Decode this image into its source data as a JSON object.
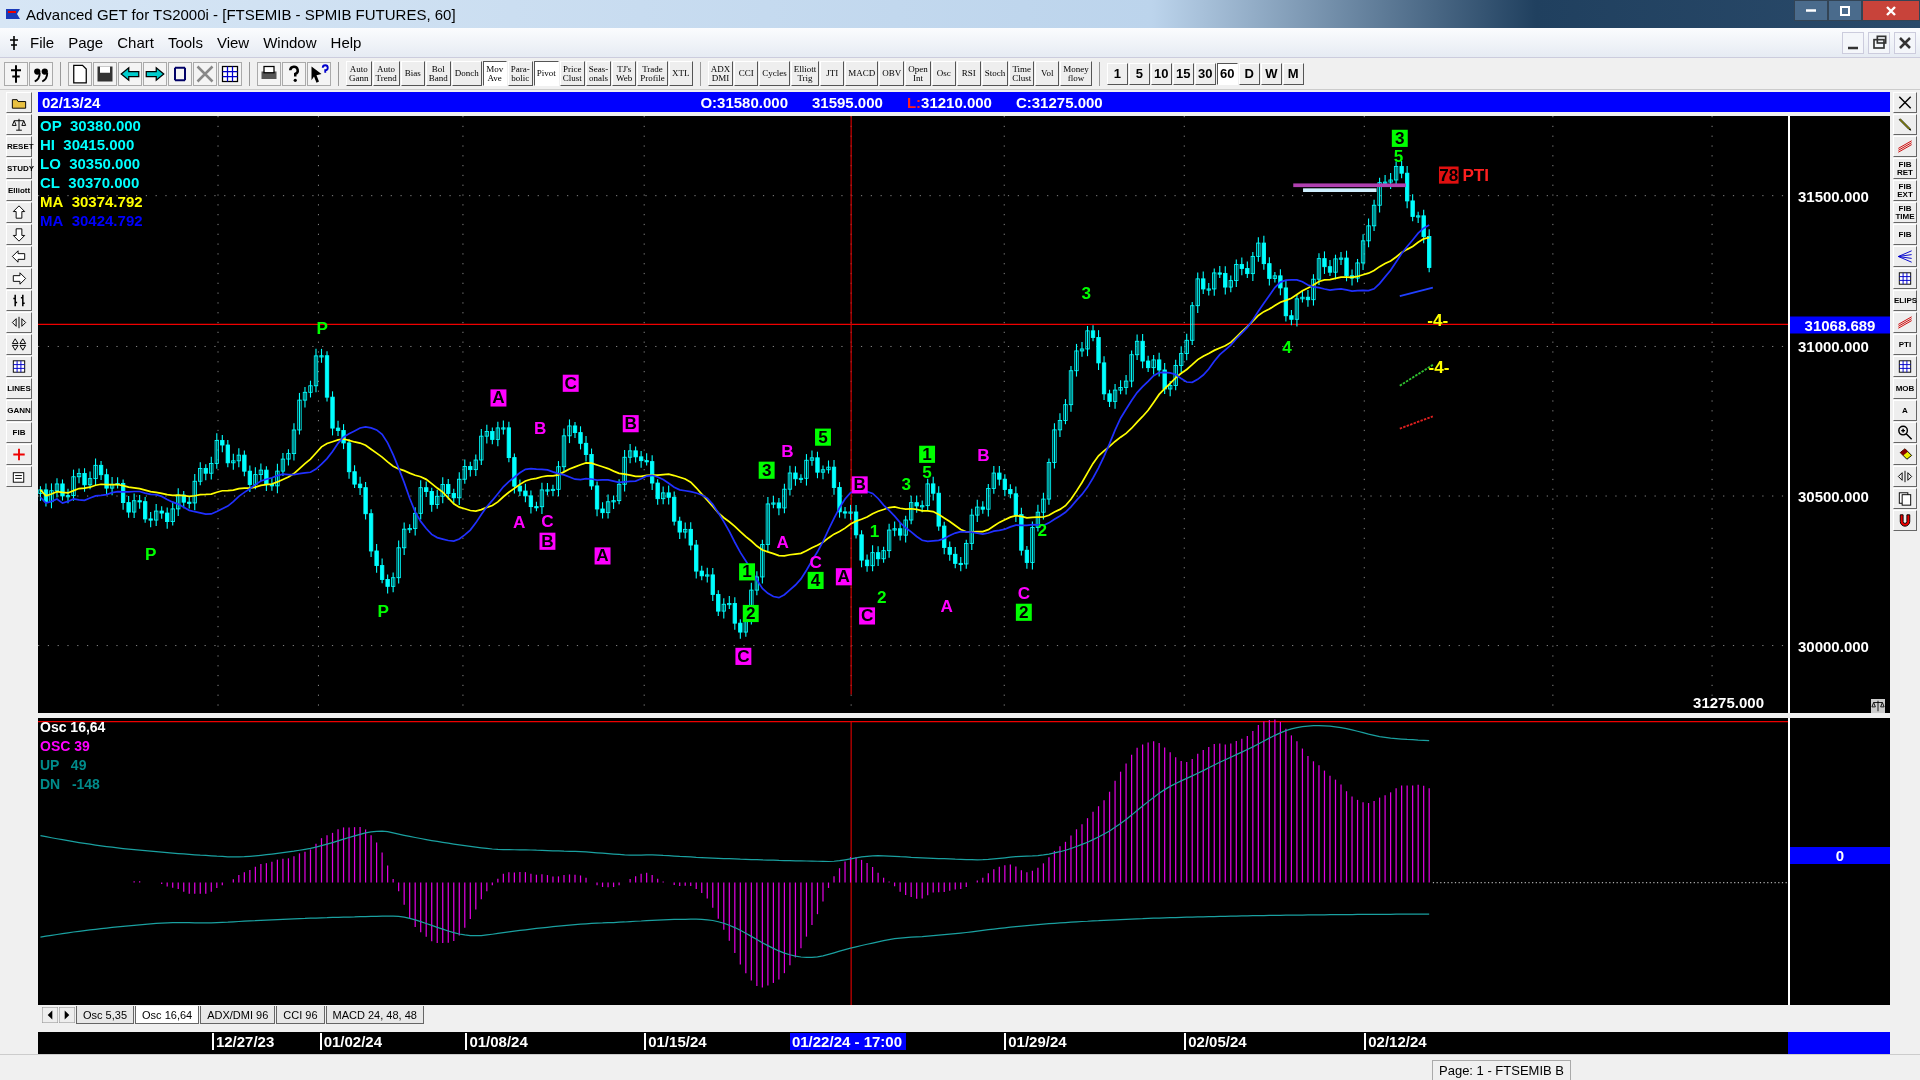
{
  "window": {
    "title": "Advanced GET for TS2000i - [FTSEMIB - SPMIB FUTURES, 60]"
  },
  "menu": [
    "File",
    "Page",
    "Chart",
    "Tools",
    "View",
    "Window",
    "Help"
  ],
  "toolbar": {
    "icons": [
      {
        "kind": "cursor"
      },
      {
        "kind": "quote"
      },
      {
        "kind": "page"
      },
      {
        "kind": "save"
      },
      {
        "kind": "back"
      },
      {
        "kind": "forward"
      },
      {
        "kind": "link"
      },
      {
        "kind": "crossout"
      },
      {
        "kind": "grid"
      },
      {
        "kind": "print"
      },
      {
        "kind": "help"
      },
      {
        "kind": "whats"
      }
    ],
    "studies": [
      {
        "label": "Auto\nGann",
        "selected": false
      },
      {
        "label": "Auto\nTrend",
        "selected": false
      },
      {
        "label": "Bias",
        "selected": false
      },
      {
        "label": "Bol\nBand",
        "selected": false
      },
      {
        "label": "Donch",
        "selected": false
      },
      {
        "label": "Mov\nAve",
        "selected": true
      },
      {
        "label": "Para-\nbolic",
        "selected": false
      },
      {
        "label": "Pivot",
        "selected": true
      },
      {
        "label": "Price\nClust",
        "selected": false
      },
      {
        "label": "Seas-\nonals",
        "selected": false
      },
      {
        "label": "TJ's\nWeb",
        "selected": false
      },
      {
        "label": "Trade\nProfile",
        "selected": false
      },
      {
        "label": "XTL",
        "selected": false
      }
    ],
    "indicators": [
      {
        "label": "ADX\nDMI",
        "selected": false
      },
      {
        "label": "CCI",
        "selected": false
      },
      {
        "label": "Cycles",
        "selected": false
      },
      {
        "label": "Elliott\nTrig",
        "selected": false
      },
      {
        "label": "JTI",
        "selected": false
      },
      {
        "label": "MACD",
        "selected": false
      },
      {
        "label": "OBV",
        "selected": false
      },
      {
        "label": "Open\nInt",
        "selected": false
      },
      {
        "label": "Osc",
        "selected": false
      },
      {
        "label": "RSI",
        "selected": false
      },
      {
        "label": "Stoch",
        "selected": false
      },
      {
        "label": "Time\nClust",
        "selected": false
      },
      {
        "label": "Vol",
        "selected": false
      },
      {
        "label": "Money\nflow",
        "selected": false
      }
    ],
    "intervals": [
      {
        "label": "1",
        "selected": false
      },
      {
        "label": "5",
        "selected": false
      },
      {
        "label": "10",
        "selected": false
      },
      {
        "label": "15",
        "selected": false
      },
      {
        "label": "30",
        "selected": false
      },
      {
        "label": "60",
        "selected": true
      },
      {
        "label": "D",
        "selected": false
      },
      {
        "label": "W",
        "selected": false
      },
      {
        "label": "M",
        "selected": false
      }
    ]
  },
  "quote_bar": {
    "date": "02/13/24",
    "items": [
      {
        "label": "O:",
        "value": "31580.000",
        "alert": false
      },
      {
        "value": "31595.000",
        "alert": false
      },
      {
        "label": "L:",
        "value": "31210.000",
        "alert": true
      },
      {
        "label": "C:",
        "value": "31275.000",
        "alert": false
      }
    ]
  },
  "legend": [
    {
      "label": "OP",
      "value": "30380.000",
      "color": "#00ffff"
    },
    {
      "label": "HI",
      "value": "30415.000",
      "color": "#00ffff"
    },
    {
      "label": "LO",
      "value": "30350.000",
      "color": "#00ffff"
    },
    {
      "label": "CL",
      "value": "30370.000",
      "color": "#00ffff"
    },
    {
      "label": "MA",
      "value": "30374.792",
      "color": "#ffff00"
    },
    {
      "label": "MA",
      "value": "30424.792",
      "color": "#0000ff"
    }
  ],
  "wave_labels": [
    {
      "text": "P",
      "boxed": false,
      "color": "#00ff00"
    },
    {
      "text": "P",
      "boxed": false,
      "color": "#00ff00"
    },
    {
      "text": "P",
      "boxed": false,
      "color": "#00ff00"
    },
    {
      "text": "A",
      "boxed": true,
      "color": "#ff00ff"
    },
    {
      "text": "C",
      "boxed": true,
      "color": "#ff00ff"
    },
    {
      "text": "B",
      "boxed": false,
      "color": "#ff00ff"
    },
    {
      "text": "B",
      "boxed": true,
      "color": "#ff00ff"
    },
    {
      "text": "A",
      "boxed": false,
      "color": "#ff00ff"
    },
    {
      "text": "C",
      "boxed": false,
      "color": "#ff00ff"
    },
    {
      "text": "B",
      "boxed": true,
      "color": "#ff00ff"
    },
    {
      "text": "A",
      "boxed": true,
      "color": "#ff00ff"
    },
    {
      "text": "3",
      "boxed": true,
      "color": "#00ff00"
    },
    {
      "text": "B",
      "boxed": false,
      "color": "#ff00ff"
    },
    {
      "text": "5",
      "boxed": true,
      "color": "#00ff00"
    },
    {
      "text": "A",
      "boxed": false,
      "color": "#ff00ff"
    },
    {
      "text": "C",
      "boxed": false,
      "color": "#ff00ff"
    },
    {
      "text": "4",
      "boxed": true,
      "color": "#00ff00"
    },
    {
      "text": "A",
      "boxed": true,
      "color": "#ff00ff"
    },
    {
      "text": "1",
      "boxed": true,
      "color": "#00ff00"
    },
    {
      "text": "2",
      "boxed": true,
      "color": "#00ff00"
    },
    {
      "text": "C",
      "boxed": true,
      "color": "#ff00ff"
    },
    {
      "text": "B",
      "boxed": true,
      "color": "#ff00ff"
    },
    {
      "text": "C",
      "boxed": true,
      "color": "#ff00ff"
    },
    {
      "text": "2",
      "boxed": false,
      "color": "#00ff00"
    },
    {
      "text": "1",
      "boxed": false,
      "color": "#00ff00"
    },
    {
      "text": "3",
      "boxed": false,
      "color": "#00ff00"
    },
    {
      "text": "1",
      "boxed": true,
      "color": "#00ff00"
    },
    {
      "text": "5",
      "boxed": false,
      "color": "#00ff00"
    },
    {
      "text": "B",
      "boxed": false,
      "color": "#ff00ff"
    },
    {
      "text": "A",
      "boxed": false,
      "color": "#ff00ff"
    },
    {
      "text": "C",
      "boxed": false,
      "color": "#ff00ff"
    },
    {
      "text": "2",
      "boxed": true,
      "color": "#00ff00"
    },
    {
      "text": "2",
      "boxed": false,
      "color": "#00ff00"
    },
    {
      "text": "3",
      "boxed": false,
      "color": "#00ff00"
    },
    {
      "text": "4",
      "boxed": false,
      "color": "#00ff00"
    },
    {
      "text": "3",
      "boxed": true,
      "color": "#00ff00"
    },
    {
      "text": "5",
      "boxed": false,
      "color": "#00ff00"
    }
  ],
  "markers": [
    {
      "kind": "box",
      "text": "78"
    },
    {
      "kind": "plain",
      "text": "PTI"
    },
    {
      "kind": "target",
      "text": "-4-"
    },
    {
      "kind": "target",
      "text": "-4-"
    }
  ],
  "price_axis": {
    "ticks": [
      "31500.000",
      "31000.000",
      "30500.000",
      "30000.000"
    ],
    "cursor": "31068.689",
    "last": "31275.000"
  },
  "oscillator": {
    "legend": [
      {
        "text": "Osc 16,64",
        "color": "#ffffff"
      },
      {
        "text": "OSC 39",
        "color": "#ff00ff"
      },
      {
        "text": "UP   49",
        "color": "#008b8b"
      },
      {
        "text": "DN   -148",
        "color": "#008b8b"
      }
    ],
    "zero": "0"
  },
  "tabs": [
    {
      "label": "Osc 5,35",
      "selected": false
    },
    {
      "label": "Osc 16,64",
      "selected": true
    },
    {
      "label": "ADX/DMI 96",
      "selected": false
    },
    {
      "label": "CCI 96",
      "selected": false
    },
    {
      "label": "MACD 24, 48, 48",
      "selected": false
    }
  ],
  "dates": [
    {
      "label": "12/27/23",
      "selected": false
    },
    {
      "label": "01/02/24",
      "selected": false
    },
    {
      "label": "01/08/24",
      "selected": false
    },
    {
      "label": "01/15/24",
      "selected": false
    },
    {
      "label": "01/22/24 - 17:00",
      "selected": true
    },
    {
      "label": "01/29/24",
      "selected": false
    },
    {
      "label": "02/05/24",
      "selected": false
    },
    {
      "label": "02/12/24",
      "selected": false
    }
  ],
  "left_tools": [
    {
      "kind": "folder"
    },
    {
      "kind": "scales"
    },
    {
      "kind": "label",
      "label": "RESET"
    },
    {
      "kind": "label",
      "label": "STUDY"
    },
    {
      "kind": "label",
      "label": "Elliott"
    },
    {
      "kind": "up"
    },
    {
      "kind": "down"
    },
    {
      "kind": "left"
    },
    {
      "kind": "right"
    },
    {
      "kind": "bars"
    },
    {
      "kind": "expand"
    },
    {
      "kind": "compress"
    },
    {
      "kind": "grid"
    },
    {
      "kind": "label",
      "label": "LINES"
    },
    {
      "kind": "label",
      "label": "GANN"
    },
    {
      "kind": "label",
      "label": "FIB"
    },
    {
      "kind": "cross"
    },
    {
      "kind": "notepad"
    }
  ],
  "right_tools": [
    {
      "kind": "close"
    },
    {
      "kind": "pencil"
    },
    {
      "kind": "lines"
    },
    {
      "kind": "label",
      "label": "FIB\nRET"
    },
    {
      "kind": "label",
      "label": "FIB\nEXT"
    },
    {
      "kind": "label",
      "label": "FIB\nTIME"
    },
    {
      "kind": "label",
      "label": "FIB"
    },
    {
      "kind": "fan"
    },
    {
      "kind": "grid"
    },
    {
      "kind": "label",
      "label": "ELIPS"
    },
    {
      "kind": "lines"
    },
    {
      "kind": "label",
      "label": "PTI"
    },
    {
      "kind": "grid"
    },
    {
      "kind": "label",
      "label": "MOB"
    },
    {
      "kind": "label",
      "label": "A"
    },
    {
      "kind": "zoom"
    },
    {
      "kind": "eraser"
    },
    {
      "kind": "expand"
    },
    {
      "kind": "pages"
    },
    {
      "kind": "magnet"
    }
  ],
  "status_bar": "Page: 1 - FTSEMIB B"
}
